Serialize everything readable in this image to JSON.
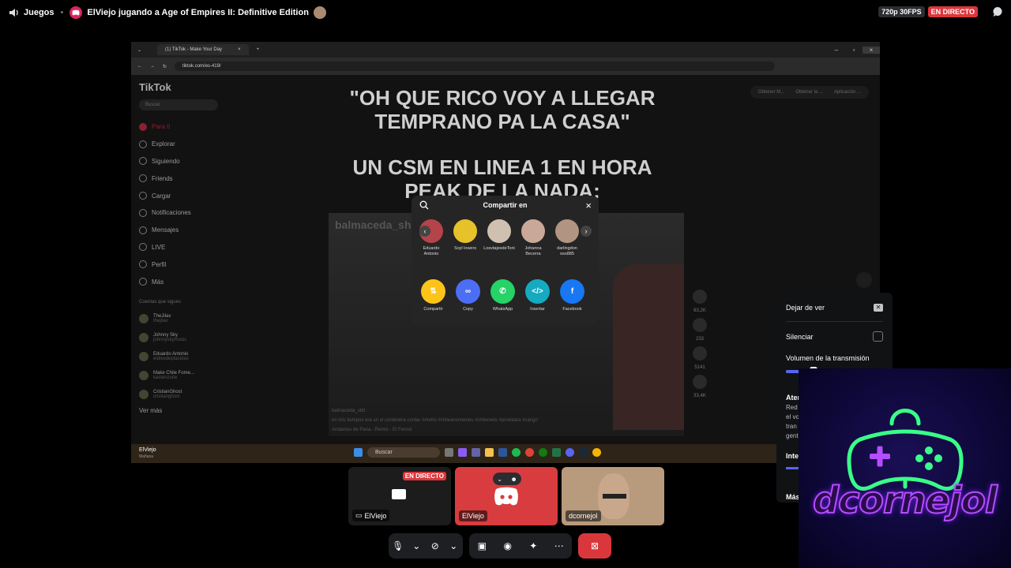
{
  "topbar": {
    "category": "Juegos",
    "title": "ElViejo jugando a Age of Empires II: Definitive Edition",
    "quality": "720p 30FPS",
    "live": "EN DIRECTO"
  },
  "browser": {
    "tab_title": "(1) TikTok - Make Your Day",
    "url": "tiktok.com/es-419/"
  },
  "tiktok": {
    "logo": "TikTok",
    "search_placeholder": "Buscar",
    "nav": [
      "Para ti",
      "Explorar",
      "Siguiendo",
      "Friends",
      "Cargar",
      "Notificaciones",
      "Mensajes",
      "LIVE",
      "Perfil",
      "Más"
    ],
    "follow_heading": "Cuentas que sigues",
    "accounts": [
      {
        "name": "TheJilax",
        "handle": "thejilax"
      },
      {
        "name": "Johnny Sky",
        "handle": "johnnyskymusic"
      },
      {
        "name": "Eduardo Antonio",
        "handle": "eldiesdeplacetas"
      },
      {
        "name": "Make Chile Fome...",
        "handle": "kastenzuite"
      },
      {
        "name": "CristianGhost",
        "handle": "cristianghost"
      }
    ],
    "see_more": "Ver más",
    "headline_1": "\"OH QUE RICO VOY A LLEGAR TEMPRANO PA LA CASA\"",
    "headline_2": "UN CSM EN LINEA 1 EN HORA PEAK DE LA NADA:",
    "video_handle": "balmaceda_sh",
    "caption_user": "balmaceda_sbtt",
    "caption_text": "en mis tiempos era un el contenera cordar #metro #chileansmemes #chilereels #pinoleara #cangri",
    "caption_music": "Andamos de Pana - Remix - El Fenod",
    "counts": [
      "63,2K",
      "233",
      "5141",
      "33,4K"
    ],
    "top_buttons": [
      "Obtener M...",
      "Obtener la ...",
      "Aplicación ..."
    ]
  },
  "share": {
    "title": "Compartir en",
    "people": [
      {
        "name": "Eduardo Antonio",
        "color": "#b5434a"
      },
      {
        "name": "Soyl lowers",
        "color": "#e7c12a"
      },
      {
        "name": "LosvtajesdeToni",
        "color": "#cfc0b0"
      },
      {
        "name": "Johanna Becerra",
        "color": "#c9a89a"
      },
      {
        "name": "darlingdon oso885",
        "color": "#b29482"
      }
    ],
    "actions": [
      {
        "label": "Compartir",
        "color": "#fcc419",
        "glyph": "⇅"
      },
      {
        "label": "Copy",
        "color": "#4c6ef5",
        "glyph": "🔗"
      },
      {
        "label": "WhatsApp",
        "color": "#25d366",
        "glyph": "✆"
      },
      {
        "label": "Insertar",
        "color": "#15aabf",
        "glyph": "</>"
      },
      {
        "label": "Facebook",
        "color": "#1877f2",
        "glyph": "f"
      }
    ]
  },
  "taskbar": {
    "user": "ElViejo",
    "sub": "Mañana",
    "search": "Buscar"
  },
  "tiles": [
    {
      "name": "ElViejo",
      "badge": "EN DIRECTO"
    },
    {
      "name": "ElViejo"
    },
    {
      "name": "dcornejol"
    }
  ],
  "menu": {
    "leave": "Dejar de ver",
    "mute": "Silenciar",
    "volume": "Volumen de la transmisión",
    "volume_level": 0.28,
    "section": "Ater",
    "desc": [
      "Red",
      "el vo",
      "tran",
      "gent"
    ],
    "intensity": "Inte",
    "more": "Más"
  },
  "overlay": {
    "brand": "dcornejol"
  },
  "colors": {
    "live_red": "#da373c",
    "blurple": "#5865f2",
    "neon_green": "#39ff88",
    "neon_purple": "#b44dff"
  }
}
